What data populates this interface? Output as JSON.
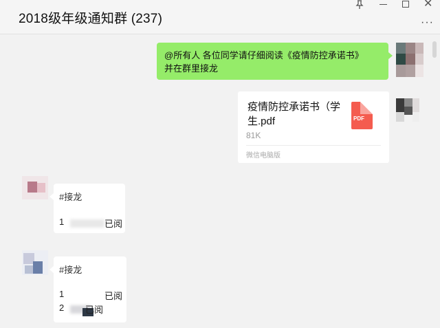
{
  "window": {
    "title": "2018级年级通知群 (237)",
    "controls": [
      "pin-icon",
      "minimize-icon",
      "maximize-icon",
      "close-icon"
    ],
    "more_label": "···"
  },
  "messages": {
    "outgoing_text": {
      "line1": "@所有人  各位同学请仔细阅读《疫情防控承诺书》",
      "line2": "并在群里接龙"
    },
    "file": {
      "name": "疫情防控承诺书（学生.pdf",
      "size": "81K",
      "source": "微信电脑版",
      "icon_label": "PDF"
    },
    "reply1": {
      "tag": "#接龙",
      "rows": [
        {
          "num": "1",
          "status": "已阅"
        }
      ]
    },
    "reply2": {
      "tag": "#接龙",
      "rows": [
        {
          "num": "1",
          "status": "已阅"
        },
        {
          "num": "2",
          "status": "已阅"
        }
      ]
    }
  },
  "colors": {
    "sent_bubble": "#95ec69",
    "background": "#f2f2f2",
    "pdf_icon": "#f45c4f"
  }
}
